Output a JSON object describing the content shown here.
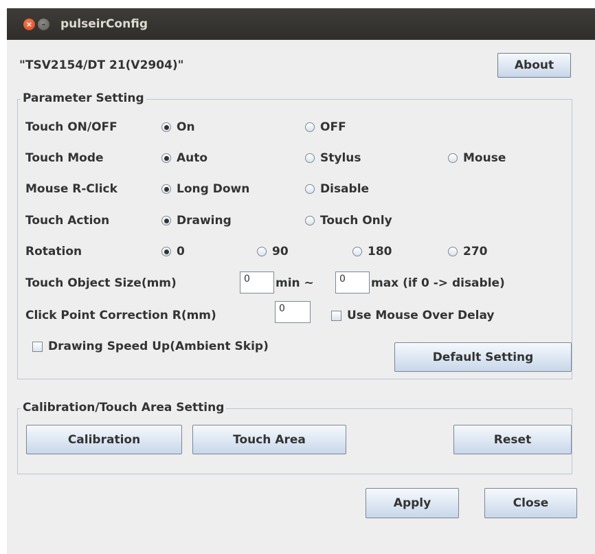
{
  "window": {
    "title": "pulseirConfig",
    "close_glyph": "×",
    "minimize_glyph": "–"
  },
  "device_label": "\"TSV2154/DT 21(V2904)\"",
  "about_label": "About",
  "parameter_setting": {
    "title": "Parameter Setting",
    "rows": [
      {
        "label": "Touch ON/OFF",
        "options": [
          {
            "label": "On",
            "selected": true
          },
          {
            "label": "OFF",
            "selected": false
          }
        ]
      },
      {
        "label": "Touch Mode",
        "options": [
          {
            "label": "Auto",
            "selected": true
          },
          {
            "label": "Stylus",
            "selected": false
          },
          {
            "label": "Mouse",
            "selected": false
          }
        ]
      },
      {
        "label": "Mouse R-Click",
        "options": [
          {
            "label": "Long Down",
            "selected": true
          },
          {
            "label": "Disable",
            "selected": false
          }
        ]
      },
      {
        "label": "Touch Action",
        "options": [
          {
            "label": "Drawing",
            "selected": true
          },
          {
            "label": "Touch Only",
            "selected": false
          }
        ]
      },
      {
        "label": "Rotation",
        "options": [
          {
            "label": "0",
            "selected": true
          },
          {
            "label": "90",
            "selected": false
          },
          {
            "label": "180",
            "selected": false
          },
          {
            "label": "270",
            "selected": false
          }
        ]
      }
    ],
    "object_size": {
      "label": "Touch Object Size(mm)",
      "min_value": "0",
      "min_suffix": "min ~",
      "max_value": "0",
      "max_suffix": "max (if 0 -> disable)"
    },
    "click_correction": {
      "label": "Click Point Correction R(mm)",
      "value": "0",
      "mouse_over_label": "Use Mouse Over Delay",
      "mouse_over_checked": false
    },
    "speed_up": {
      "label": "Drawing Speed Up(Ambient Skip)",
      "checked": false
    },
    "default_button": "Default Setting"
  },
  "calibration": {
    "title": "Calibration/Touch Area Setting",
    "calibration_button": "Calibration",
    "touch_area_button": "Touch Area",
    "reset_button": "Reset"
  },
  "footer": {
    "apply_button": "Apply",
    "close_button": "Close"
  }
}
